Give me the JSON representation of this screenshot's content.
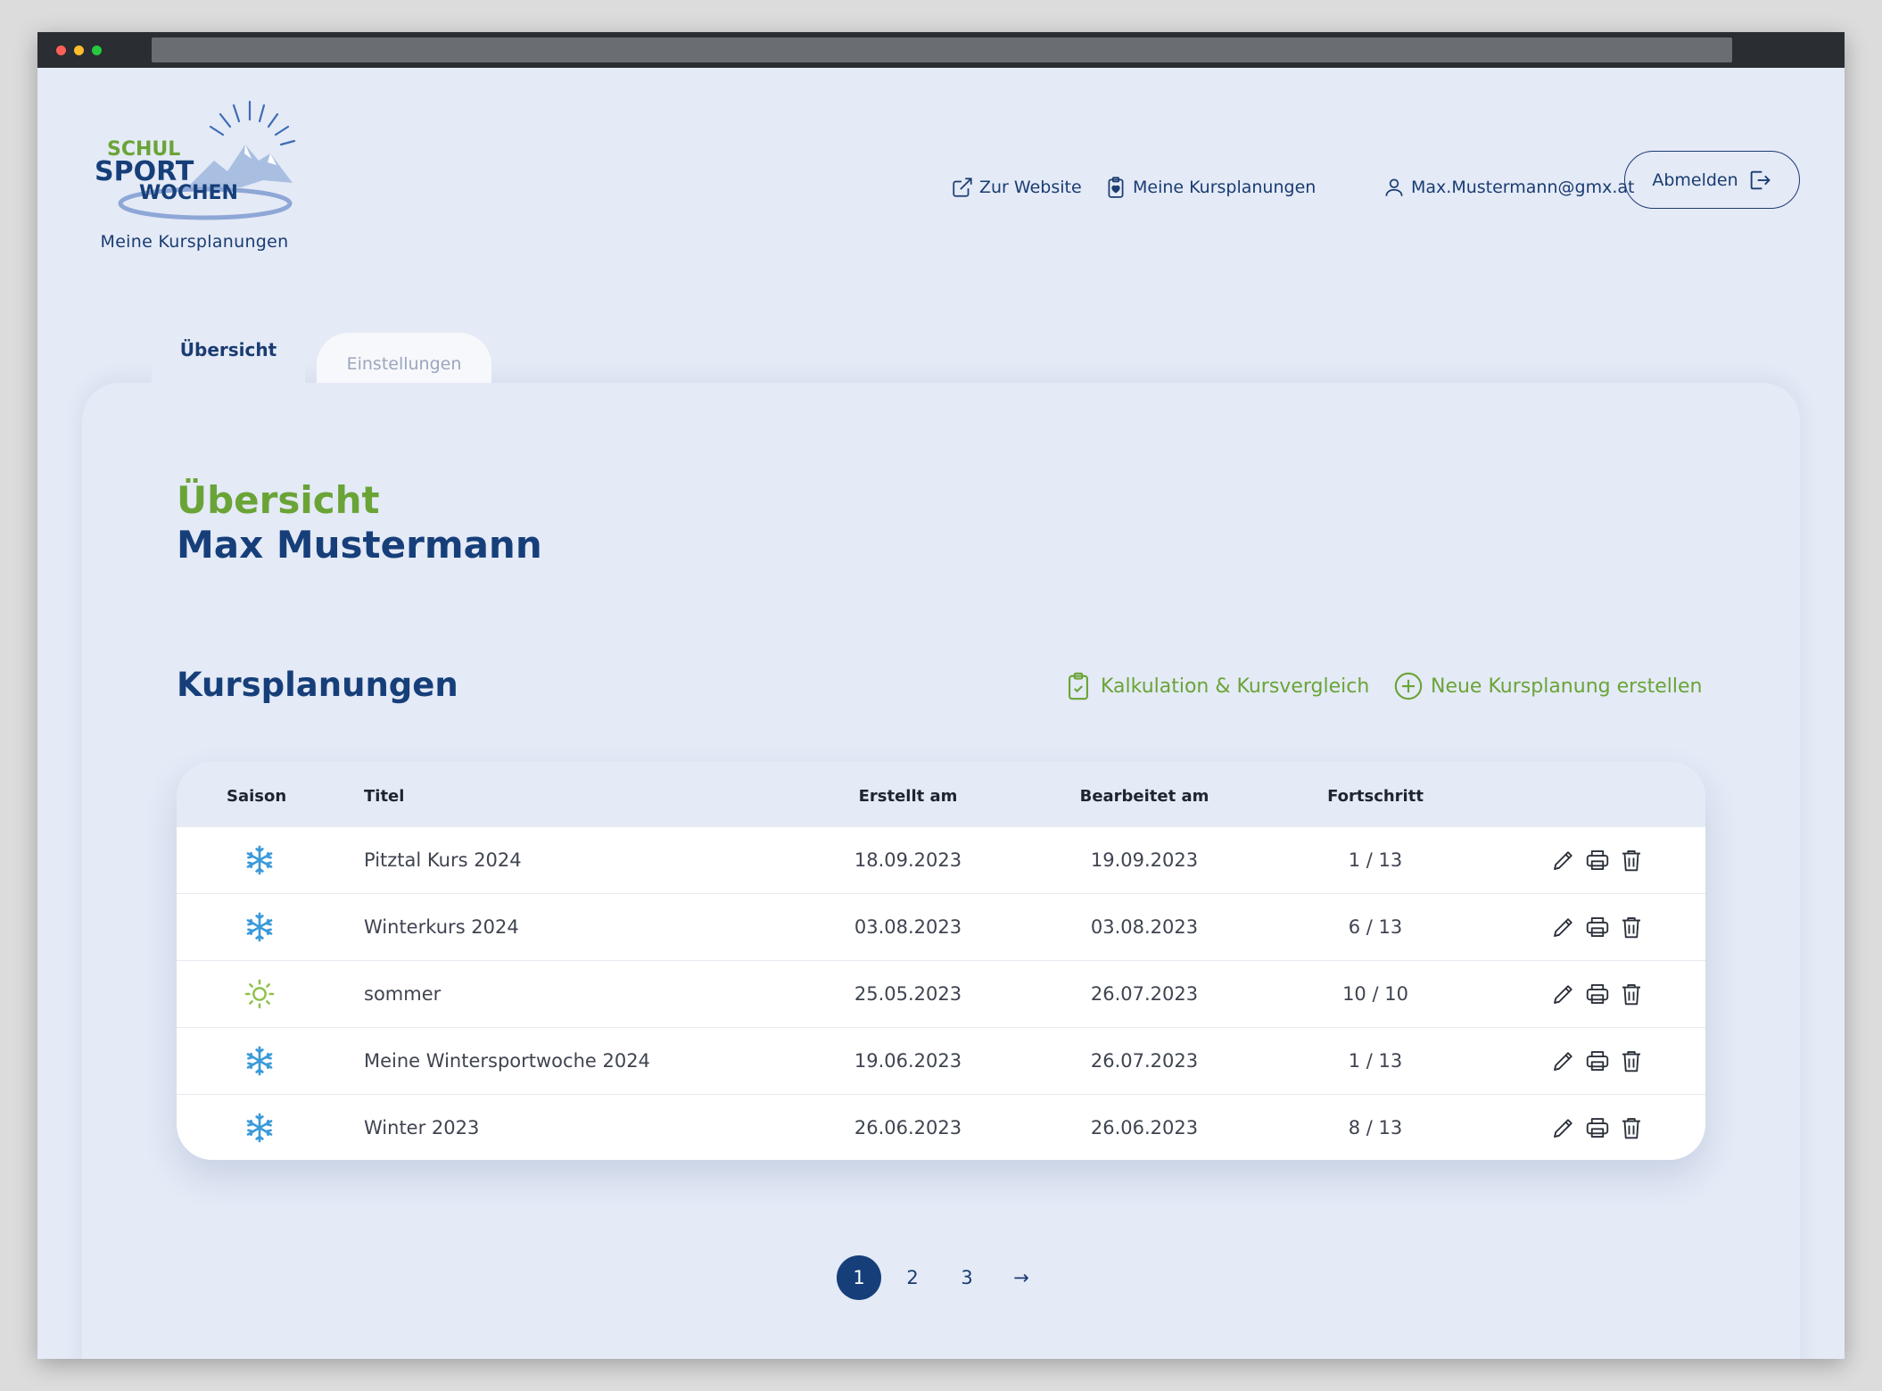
{
  "brand": {
    "logo_line1": "SCHUL",
    "logo_line2": "SPORT",
    "logo_line3": "WOCHEN",
    "subtitle": "Meine Kursplanungen"
  },
  "topnav": {
    "website": "Zur Website",
    "plans": "Meine Kursplanungen",
    "user": "Max.Mustermann@gmx.at",
    "logout": "Abmelden"
  },
  "tabs": [
    {
      "label": "Übersicht",
      "active": true
    },
    {
      "label": "Einstellungen",
      "active": false
    }
  ],
  "overview": {
    "heading": "Übersicht",
    "name": "Max Mustermann",
    "section_title": "Kursplanungen",
    "action_calc": "Kalkulation & Kursvergleich",
    "action_new": "Neue Kursplanung erstellen"
  },
  "table": {
    "headers": [
      "Saison",
      "Titel",
      "Erstellt am",
      "Bearbeitet am",
      "Fortschritt"
    ],
    "rows": [
      {
        "season": "winter",
        "title": "Pitztal Kurs 2024",
        "created": "18.09.2023",
        "edited": "19.09.2023",
        "progress": "1 / 13"
      },
      {
        "season": "winter",
        "title": "Winterkurs 2024",
        "created": "03.08.2023",
        "edited": "03.08.2023",
        "progress": "6 / 13"
      },
      {
        "season": "summer",
        "title": "sommer",
        "created": "25.05.2023",
        "edited": "26.07.2023",
        "progress": "10 / 10"
      },
      {
        "season": "winter",
        "title": "Meine Wintersportwoche 2024",
        "created": "19.06.2023",
        "edited": "26.07.2023",
        "progress": "1 / 13"
      },
      {
        "season": "winter",
        "title": "Winter 2023",
        "created": "26.06.2023",
        "edited": "26.06.2023",
        "progress": "8 / 13"
      }
    ]
  },
  "pagination": {
    "pages": [
      "1",
      "2",
      "3"
    ],
    "current": "1",
    "next": "→"
  },
  "colors": {
    "primary": "#163f7a",
    "accent_green": "#6aa437",
    "winter_icon": "#3a9ad9",
    "summer_icon": "#8fc14a",
    "background": "#e4eaf6"
  },
  "icons": {
    "website": "external-link-icon",
    "plans": "clipboard-heart-icon",
    "user": "user-icon",
    "logout": "logout-icon",
    "calc": "clipboard-check-icon",
    "new": "plus-circle-icon",
    "winter": "snowflake-icon",
    "summer": "sun-icon",
    "edit": "pencil-icon",
    "print": "printer-icon",
    "delete": "trash-icon"
  }
}
